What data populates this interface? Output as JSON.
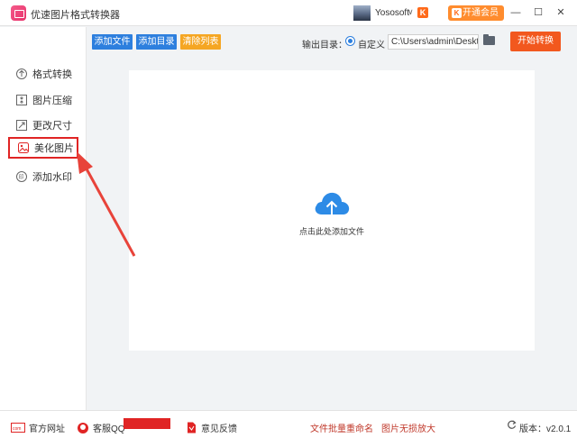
{
  "app": {
    "title": "优速图片格式转换器"
  },
  "user": {
    "name": "Yososoft",
    "chevron": "∨",
    "vip_k": "K",
    "vip_button": "开通会员"
  },
  "window_controls": {
    "minimize": "—",
    "maximize": "☐",
    "close": "✕"
  },
  "sidebar": {
    "items": [
      {
        "label": "格式转换",
        "icon": "format-convert-icon"
      },
      {
        "label": "图片压缩",
        "icon": "compress-icon"
      },
      {
        "label": "更改尺寸",
        "icon": "resize-icon"
      },
      {
        "label": "美化图片",
        "icon": "beautify-icon",
        "active": true
      },
      {
        "label": "添加水印",
        "icon": "watermark-icon"
      }
    ]
  },
  "toolbar": {
    "add_file": "添加文件",
    "add_folder": "添加目录",
    "clear_list": "清除列表",
    "output_label": "输出目录：",
    "custom_label": "自定义",
    "output_path": "C:\\Users\\admin\\Deskto",
    "start_button": "开始转换"
  },
  "drop_area": {
    "hint": "点击此处添加文件"
  },
  "footer": {
    "website": "官方网址",
    "qq": "客服QQ",
    "feedback": "意见反馈",
    "batch_rename": "文件批量重命名",
    "lossless_zoom": "图片无损放大",
    "version": "版本：v2.0.1"
  },
  "colors": {
    "accent_blue": "#2d7fde",
    "clear_orange": "#f5a623",
    "start_orange": "#f2581e",
    "vip_orange": "#ff8c2e",
    "highlight_red": "#e02424",
    "link_red": "#c0392b"
  }
}
